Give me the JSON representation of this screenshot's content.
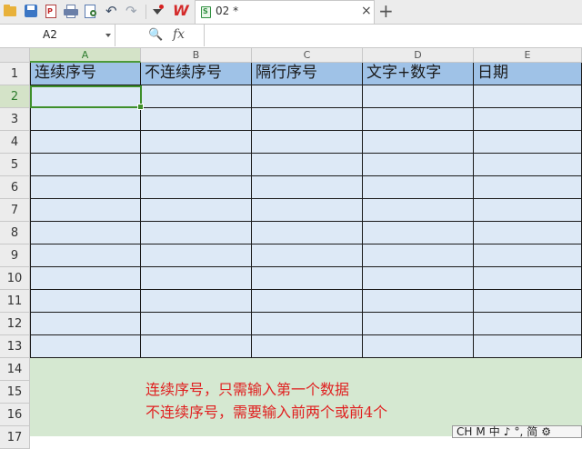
{
  "toolbar": {
    "redo_glyph": "↷",
    "undo_glyph": "↶",
    "wps_logo": "W",
    "pdf_label": "P"
  },
  "tab": {
    "title": "02 *",
    "close_glyph": "×",
    "new_tab_glyph": "+",
    "file_badge": "S"
  },
  "formula_bar": {
    "cell_ref": "A2",
    "zoom_glyph": "🔍",
    "fx_label": "fx",
    "value": ""
  },
  "sheet": {
    "columns": [
      "A",
      "B",
      "C",
      "D",
      "E"
    ],
    "active_column": "A",
    "rows": [
      "1",
      "2",
      "3",
      "4",
      "5",
      "6",
      "7",
      "8",
      "9",
      "10",
      "11",
      "12",
      "13",
      "14",
      "15",
      "16",
      "17"
    ],
    "active_row": "2",
    "headers": [
      "连续序号",
      "不连续序号",
      "隔行序号",
      "文字+数字",
      "日期"
    ],
    "notes": [
      "连续序号，只需输入第一个数据",
      "不连续序号，需要输入前两个或前4个"
    ]
  },
  "ime": {
    "items": [
      "CH",
      "M",
      "中",
      "♪",
      "°,",
      "简",
      "⚙"
    ]
  },
  "colors": {
    "header_fill": "#9fc2e7",
    "body_fill": "#dde9f6",
    "notes_fill": "#d5e8d1",
    "note_text": "#e02020",
    "selection": "#3e8f2a"
  }
}
